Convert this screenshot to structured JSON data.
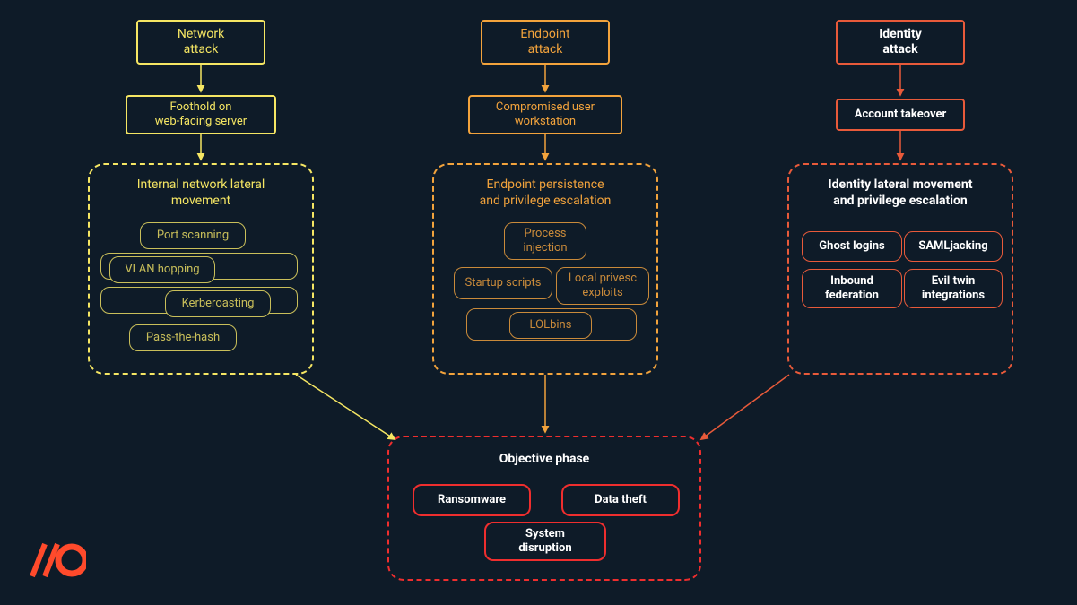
{
  "colors": {
    "background": "#0e1b28",
    "yellow": "#f5e663",
    "yellow_soft": "#c9bf5a",
    "orange": "#f2a33c",
    "orange_soft": "#c98a3a",
    "identity_red": "#e85a3a",
    "red": "#ef2e2e",
    "logo": "#ff4a2b"
  },
  "columns": {
    "network": {
      "title": "Network\nattack",
      "foothold": "Foothold on\nweb-facing server",
      "group_title": "Internal network lateral\nmovement",
      "techniques": {
        "port_scanning": "Port scanning",
        "vlan_hopping": "VLAN hopping",
        "kerberoasting": "Kerberoasting",
        "pass_the_hash": "Pass-the-hash"
      }
    },
    "endpoint": {
      "title": "Endpoint\nattack",
      "foothold": "Compromised user\nworkstation",
      "group_title": "Endpoint persistence\nand privilege escalation",
      "techniques": {
        "process_injection": "Process\ninjection",
        "startup_scripts": "Startup scripts",
        "local_privesc": "Local privesc\nexploits",
        "lolbins": "LOLbins"
      }
    },
    "identity": {
      "title": "Identity\nattack",
      "foothold": "Account takeover",
      "group_title": "Identity lateral movement\nand privilege escalation",
      "techniques": {
        "ghost_logins": "Ghost logins",
        "samljacking": "SAMLjacking",
        "inbound_federation": "Inbound\nfederation",
        "evil_twin": "Evil twin\nintegrations"
      }
    }
  },
  "objective": {
    "title": "Objective phase",
    "items": {
      "ransomware": "Ransomware",
      "data_theft": "Data theft",
      "system_disruption": "System\ndisruption"
    }
  }
}
